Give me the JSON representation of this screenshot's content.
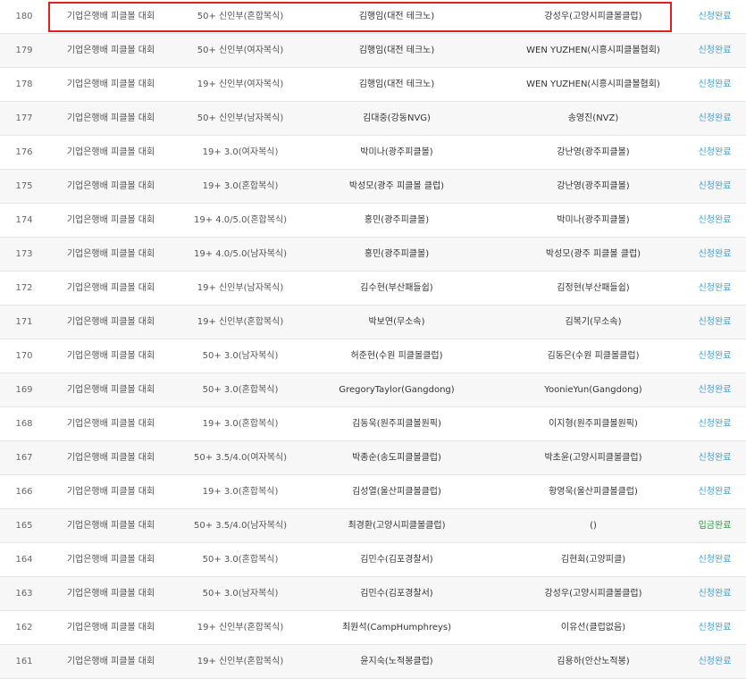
{
  "rows": [
    {
      "no": "180",
      "event": "기업은행배 피클볼 대회",
      "division": "50+ 신인부(혼합복식)",
      "player1": "김행임(대전 테크노)",
      "player2": "강성우(고양시피클볼클럽)",
      "status": "신청완료"
    },
    {
      "no": "179",
      "event": "기업은행배 피클볼 대회",
      "division": "50+ 신인부(여자복식)",
      "player1": "김행임(대전 테크노)",
      "player2": "WEN YUZHEN(시흥시피클볼협회)",
      "status": "신청완료"
    },
    {
      "no": "178",
      "event": "기업은행배 피클볼 대회",
      "division": "19+ 신인부(여자복식)",
      "player1": "김행임(대전 테크노)",
      "player2": "WEN YUZHEN(시흥시피클볼협회)",
      "status": "신청완료"
    },
    {
      "no": "177",
      "event": "기업은행배 피클볼 대회",
      "division": "50+ 신인부(남자복식)",
      "player1": "김대중(강동NVG)",
      "player2": "송영진(NVZ)",
      "status": "신청완료"
    },
    {
      "no": "176",
      "event": "기업은행배 피클볼 대회",
      "division": "19+ 3.0(여자복식)",
      "player1": "박미나(광주피클볼)",
      "player2": "강난영(광주피클볼)",
      "status": "신청완료"
    },
    {
      "no": "175",
      "event": "기업은행배 피클볼 대회",
      "division": "19+ 3.0(혼합복식)",
      "player1": "박성모(광주 피클볼 클럽)",
      "player2": "강난영(광주피클볼)",
      "status": "신청완료"
    },
    {
      "no": "174",
      "event": "기업은행배 피클볼 대회",
      "division": "19+ 4.0/5.0(혼합복식)",
      "player1": "홍민(광주피클볼)",
      "player2": "박미나(광주피클볼)",
      "status": "신청완료"
    },
    {
      "no": "173",
      "event": "기업은행배 피클볼 대회",
      "division": "19+ 4.0/5.0(남자복식)",
      "player1": "홍민(광주피클볼)",
      "player2": "박성모(광주 피클볼 클럽)",
      "status": "신청완료"
    },
    {
      "no": "172",
      "event": "기업은행배 피클볼 대회",
      "division": "19+ 신인부(남자복식)",
      "player1": "김수현(부산패들쉽)",
      "player2": "김정현(부산패들쉽)",
      "status": "신청완료"
    },
    {
      "no": "171",
      "event": "기업은행배 피클볼 대회",
      "division": "19+ 신인부(혼합복식)",
      "player1": "박보연(무소속)",
      "player2": "김복기(무소속)",
      "status": "신청완료"
    },
    {
      "no": "170",
      "event": "기업은행배 피클볼 대회",
      "division": "50+ 3.0(남자복식)",
      "player1": "허준현(수원 피클볼클럽)",
      "player2": "김동은(수원 피클볼클럽)",
      "status": "신청완료"
    },
    {
      "no": "169",
      "event": "기업은행배 피클볼 대회",
      "division": "50+ 3.0(혼합복식)",
      "player1": "GregoryTaylor(Gangdong)",
      "player2": "YoonieYun(Gangdong)",
      "status": "신청완료"
    },
    {
      "no": "168",
      "event": "기업은행배 피클볼 대회",
      "division": "19+ 3.0(혼합복식)",
      "player1": "김동욱(원주피클볼원픽)",
      "player2": "이지형(원주피클볼원픽)",
      "status": "신청완료"
    },
    {
      "no": "167",
      "event": "기업은행배 피클볼 대회",
      "division": "50+ 3.5/4.0(여자복식)",
      "player1": "박종순(송도피클볼클럽)",
      "player2": "박초윤(고양시피클볼클럽)",
      "status": "신청완료"
    },
    {
      "no": "166",
      "event": "기업은행배 피클볼 대회",
      "division": "19+ 3.0(혼합복식)",
      "player1": "김성열(울산피클볼클럽)",
      "player2": "황영욱(울산피클볼클럽)",
      "status": "신청완료"
    },
    {
      "no": "165",
      "event": "기업은행배 피클볼 대회",
      "division": "50+ 3.5/4.0(남자복식)",
      "player1": "최경환(고양시피클볼클럽)",
      "player2": "()",
      "status": "입금완료"
    },
    {
      "no": "164",
      "event": "기업은행배 피클볼 대회",
      "division": "50+ 3.0(혼합복식)",
      "player1": "김민수(김포경찰서)",
      "player2": "김현회(고양피클)",
      "status": "신청완료"
    },
    {
      "no": "163",
      "event": "기업은행배 피클볼 대회",
      "division": "50+ 3.0(남자복식)",
      "player1": "김민수(김포경찰서)",
      "player2": "강성우(고양시피클볼클럽)",
      "status": "신청완료"
    },
    {
      "no": "162",
      "event": "기업은행배 피클볼 대회",
      "division": "19+ 신인부(혼합복식)",
      "player1": "최원석(CampHumphreys)",
      "player2": "이유선(클럽없음)",
      "status": "신청완료"
    },
    {
      "no": "161",
      "event": "기업은행배 피클볼 대회",
      "division": "19+ 신인부(혼합복식)",
      "player1": "윤지숙(노적봉클럽)",
      "player2": "김용하(안산노적봉)",
      "status": "신청완료"
    }
  ],
  "status_colors": {
    "신청완료": "#3aa0d8",
    "입금완료": "#2e9a40"
  },
  "highlight_color": "#e02020"
}
